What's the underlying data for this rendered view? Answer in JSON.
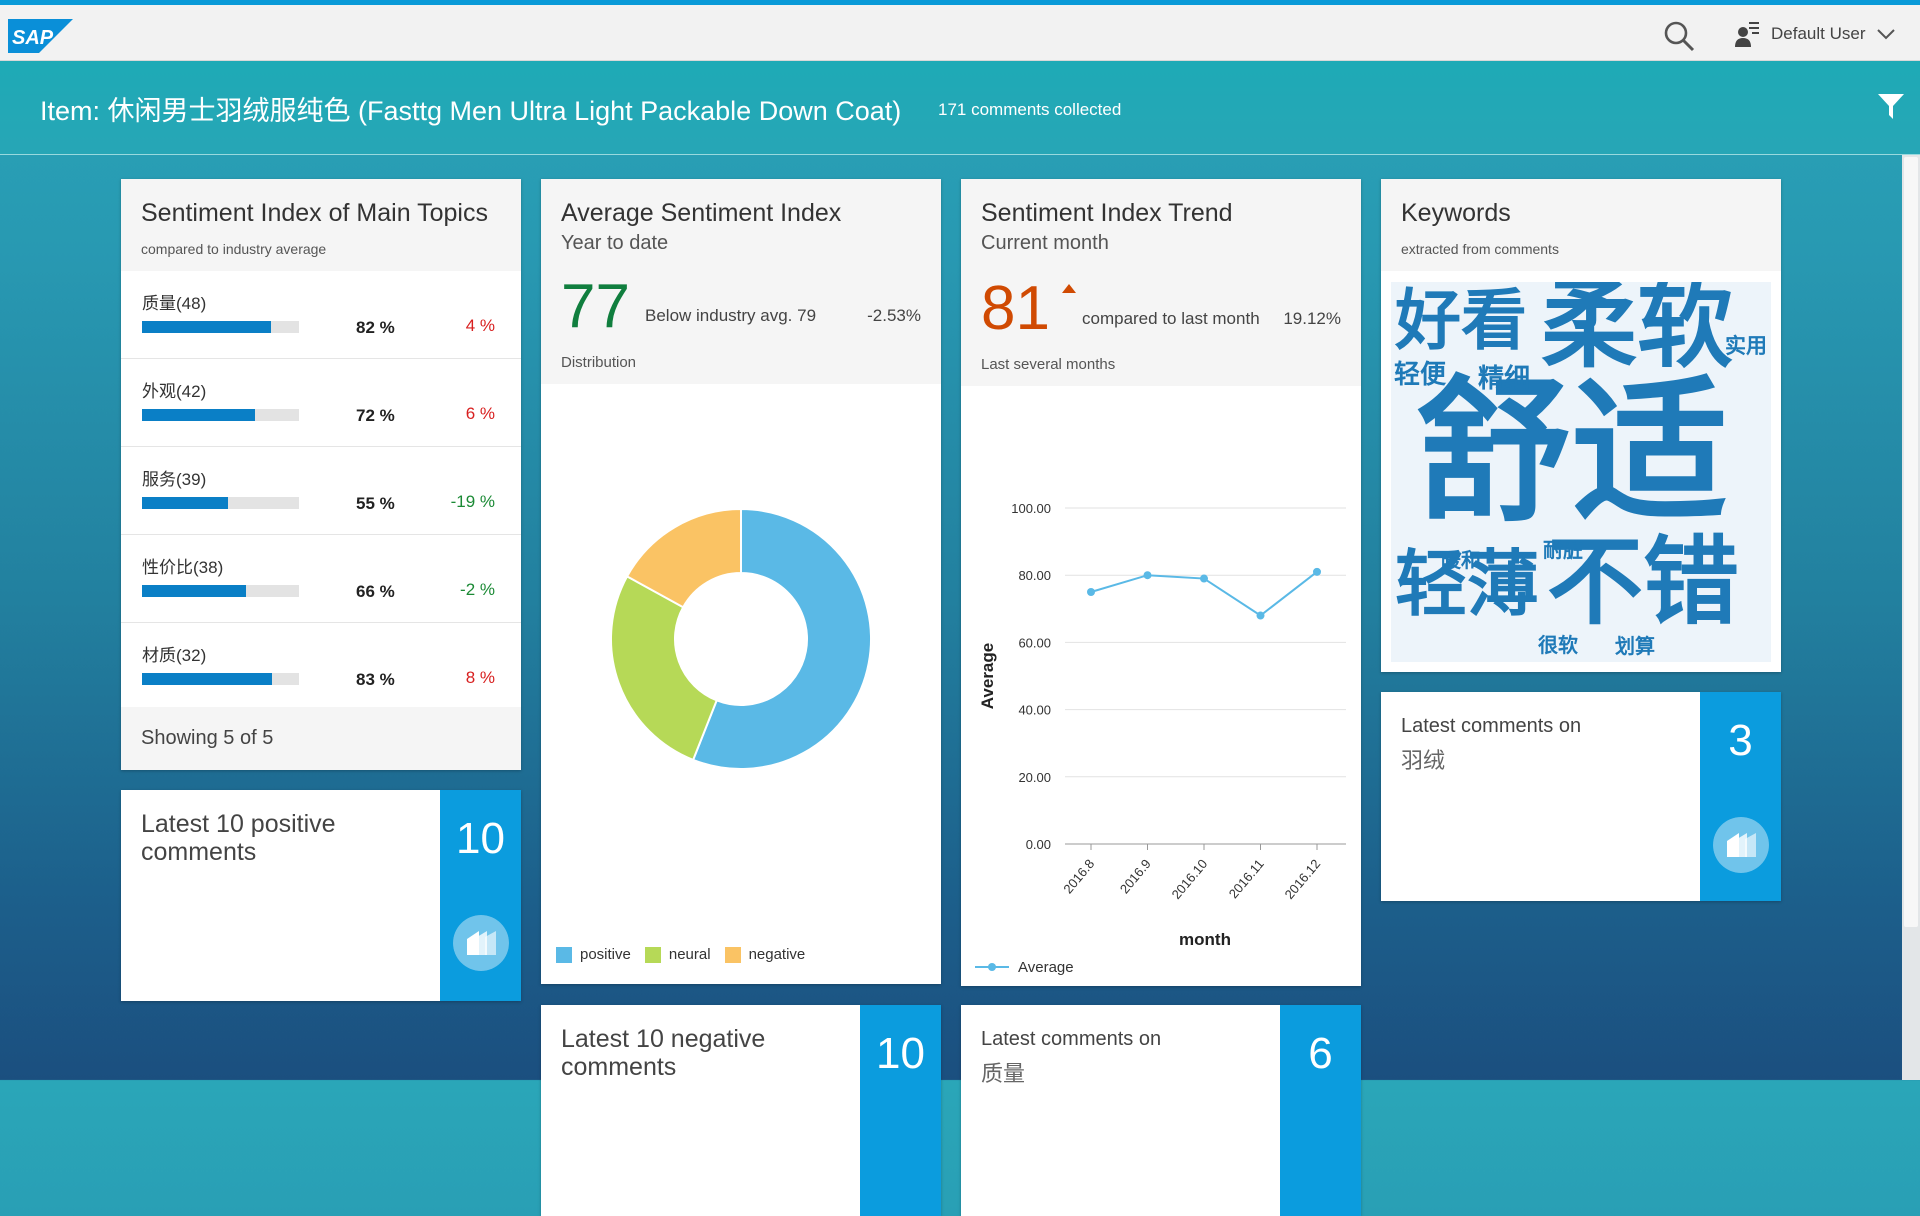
{
  "shell": {
    "logo_text": "SAP",
    "user_name": "Default User"
  },
  "header": {
    "item_prefix": "Item: ",
    "item_name": "休闲男士羽绒服纯色 (Fasttg Men Ultra Light Packable Down Coat)",
    "comments_count": "171 comments collected"
  },
  "topics_card": {
    "title": "Sentiment Index of Main Topics",
    "subtitle": "compared to industry average",
    "rows": [
      {
        "label": "质量(48)",
        "pct_text": "82 %",
        "pct": 82,
        "delta": "4 %",
        "trend": "negative"
      },
      {
        "label": "外观(42)",
        "pct_text": "72 %",
        "pct": 72,
        "delta": "6 %",
        "trend": "negative"
      },
      {
        "label": "服务(39)",
        "pct_text": "55 %",
        "pct": 55,
        "delta": "-19 %",
        "trend": "positive"
      },
      {
        "label": "性价比(38)",
        "pct_text": "66 %",
        "pct": 66,
        "delta": "-2 %",
        "trend": "positive"
      },
      {
        "label": "材质(32)",
        "pct_text": "83 %",
        "pct": 83,
        "delta": "8 %",
        "trend": "negative"
      }
    ],
    "footer": "Showing 5 of 5"
  },
  "avg_card": {
    "title": "Average Sentiment Index",
    "subtitle": "Year to date",
    "value": "77",
    "compare_text": "Below industry avg. 79",
    "delta": "-2.53%",
    "distribution_label": "Distribution",
    "legend": [
      {
        "label": "positive",
        "color": "#5ab9e6"
      },
      {
        "label": "neural",
        "color": "#b6d957"
      },
      {
        "label": "negative",
        "color": "#fac364"
      }
    ]
  },
  "trend_card": {
    "title": "Sentiment Index Trend",
    "subtitle": "Current month",
    "value": "81",
    "compare_text": "compared to last month",
    "delta": "19.12%",
    "period_label": "Last several months",
    "legend_label": "Average",
    "line_color": "#5ab9e6",
    "value_color": "#d04a02"
  },
  "keywords_card": {
    "title": "Keywords",
    "subtitle": "extracted from comments",
    "words": [
      {
        "text": "舒适",
        "weight": 100
      },
      {
        "text": "柔软",
        "weight": 52
      },
      {
        "text": "不错",
        "weight": 50
      },
      {
        "text": "好看",
        "weight": 40
      },
      {
        "text": "轻薄",
        "weight": 40
      },
      {
        "text": "精细",
        "weight": 14
      },
      {
        "text": "轻便",
        "weight": 14
      },
      {
        "text": "实用",
        "weight": 11
      },
      {
        "text": "暖和",
        "weight": 11
      },
      {
        "text": "耐脏",
        "weight": 11
      },
      {
        "text": "很软",
        "weight": 11
      },
      {
        "text": "划算",
        "weight": 11
      }
    ]
  },
  "tiles": {
    "positive": {
      "text": "Latest 10 positive comments",
      "count": "10"
    },
    "yurong": {
      "text_line1": "Latest comments on",
      "text_line2": "羽绒",
      "count": "3"
    },
    "negative": {
      "text": "Latest 10 negative comments",
      "count": "10"
    },
    "zhiliang": {
      "text_line1": "Latest comments on",
      "text_line2": "质量",
      "count": "6"
    }
  },
  "chart_data": [
    {
      "type": "pie",
      "title": "Distribution",
      "categories": [
        "positive",
        "neural",
        "negative"
      ],
      "values": [
        56,
        27,
        17
      ],
      "colors": [
        "#5ab9e6",
        "#b6d957",
        "#fac364"
      ],
      "donut": true
    },
    {
      "type": "line",
      "title": "",
      "xlabel": "month",
      "ylabel": "Average",
      "x": [
        "2016.8",
        "2016.9",
        "2016.10",
        "2016.11",
        "2016.12"
      ],
      "series": [
        {
          "name": "Average",
          "values": [
            75,
            80,
            79,
            68,
            81
          ]
        }
      ],
      "ylim": [
        0,
        100
      ],
      "yticks": [
        "0.00",
        "20.00",
        "40.00",
        "60.00",
        "80.00",
        "100.00"
      ],
      "grid": true,
      "legend": "bottom-left"
    }
  ]
}
